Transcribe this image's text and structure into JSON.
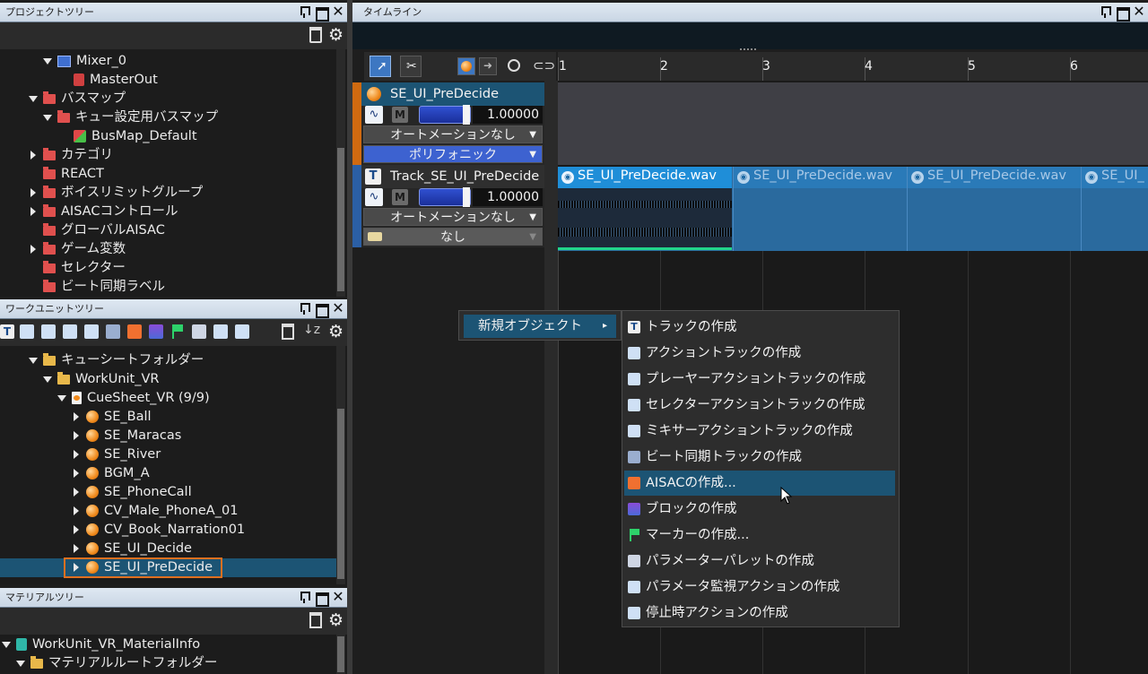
{
  "project_tree": {
    "title": "プロジェクトツリー",
    "items": [
      {
        "label": "Mixer_0"
      },
      {
        "label": "MasterOut"
      },
      {
        "label": "バスマップ"
      },
      {
        "label": "キュー設定用バスマップ"
      },
      {
        "label": "BusMap_Default"
      },
      {
        "label": "カテゴリ"
      },
      {
        "label": "REACT"
      },
      {
        "label": "ボイスリミットグループ"
      },
      {
        "label": "AISACコントロール"
      },
      {
        "label": "グローバルAISAC"
      },
      {
        "label": "ゲーム変数"
      },
      {
        "label": "セレクター"
      },
      {
        "label": "ビート同期ラベル"
      }
    ]
  },
  "workunit_tree": {
    "title": "ワークユニットツリー",
    "items": [
      {
        "label": "キューシートフォルダー"
      },
      {
        "label": "WorkUnit_VR"
      },
      {
        "label": "CueSheet_VR (9/9)"
      },
      {
        "label": "SE_Ball"
      },
      {
        "label": "SE_Maracas"
      },
      {
        "label": "SE_River"
      },
      {
        "label": "BGM_A"
      },
      {
        "label": "SE_PhoneCall"
      },
      {
        "label": "CV_Male_PhoneA_01"
      },
      {
        "label": "CV_Book_Narration01"
      },
      {
        "label": "SE_UI_Decide"
      },
      {
        "label": "SE_UI_PreDecide"
      }
    ]
  },
  "material_tree": {
    "title": "マテリアルツリー",
    "items": [
      {
        "label": "WorkUnit_VR_MaterialInfo"
      },
      {
        "label": "マテリアルルートフォルダー"
      }
    ]
  },
  "timeline": {
    "title": "タイムライン",
    "ruler": [
      "1",
      "2",
      "3",
      "4",
      "5",
      "6"
    ],
    "cue": {
      "name": "SE_UI_PreDecide",
      "mute": "M",
      "volume": "1.00000",
      "automation": "オートメーションなし",
      "mode": "ポリフォニック"
    },
    "track": {
      "name": "Track_SE_UI_PreDecide",
      "type_icon": "T",
      "mute": "M",
      "volume": "1.00000",
      "automation": "オートメーションなし",
      "option": "なし"
    },
    "waveforms": [
      "SE_UI_PreDecide.wav",
      "SE_UI_PreDecide.wav",
      "SE_UI_PreDecide.wav",
      "SE_UI_"
    ]
  },
  "context_menu": {
    "parent_label": "新規オブジェクト",
    "items": [
      {
        "label": "トラックの作成",
        "icon": "track-icon"
      },
      {
        "label": "アクショントラックの作成",
        "icon": "action-track-icon"
      },
      {
        "label": "プレーヤーアクショントラックの作成",
        "icon": "player-action-icon"
      },
      {
        "label": "セレクターアクショントラックの作成",
        "icon": "selector-action-icon"
      },
      {
        "label": "ミキサーアクショントラックの作成",
        "icon": "mixer-action-icon"
      },
      {
        "label": "ビート同期トラックの作成",
        "icon": "beat-sync-icon"
      },
      {
        "label": "AISACの作成...",
        "icon": "aisac-icon"
      },
      {
        "label": "ブロックの作成",
        "icon": "block-icon"
      },
      {
        "label": "マーカーの作成...",
        "icon": "marker-icon"
      },
      {
        "label": "パラメーターパレットの作成",
        "icon": "param-palette-icon"
      },
      {
        "label": "パラメータ監視アクションの作成",
        "icon": "param-watch-icon"
      },
      {
        "label": "停止時アクションの作成",
        "icon": "stop-action-icon"
      }
    ]
  },
  "colors": {
    "selection": "#1c5474",
    "accent_orange": "#e07020",
    "waveform_bg": "#1f6aa4"
  }
}
